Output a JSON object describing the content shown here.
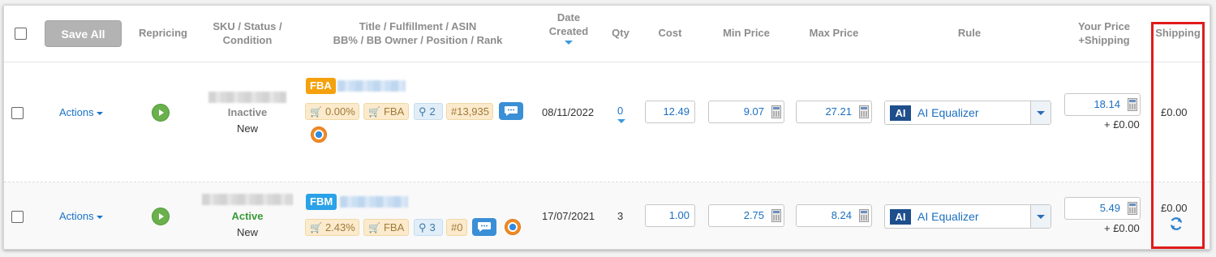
{
  "header": {
    "save_all": "Save All",
    "repricing": "Repricing",
    "sku_line1": "SKU / Status /",
    "sku_line2": "Condition",
    "title_line1": "Title / Fulfillment / ASIN",
    "title_line2": "BB% / BB Owner / Position / Rank",
    "date_line1": "Date",
    "date_line2": "Created",
    "qty": "Qty",
    "cost": "Cost",
    "min_price": "Min Price",
    "max_price": "Max Price",
    "rule": "Rule",
    "your_price_line1": "Your Price",
    "your_price_line2": "+Shipping",
    "shipping": "Shipping"
  },
  "rows": [
    {
      "actions": "Actions",
      "status": "Inactive",
      "condition": "New",
      "fulfillment": "FBA",
      "bb_percent": "0.00%",
      "bb_owner": "FBA",
      "position": "2",
      "rank": "#13,935",
      "date": "08/11/2022",
      "qty": "0",
      "cost": "12.49",
      "min_price": "9.07",
      "max_price": "27.21",
      "rule_badge": "AI",
      "rule": "AI Equalizer",
      "your_price": "18.14",
      "plus_shipping": "+ £0.00",
      "shipping": "£0.00"
    },
    {
      "actions": "Actions",
      "status": "Active",
      "condition": "New",
      "fulfillment": "FBM",
      "bb_percent": "2.43%",
      "bb_owner": "FBA",
      "position": "3",
      "rank": "#0",
      "date": "17/07/2021",
      "qty": "3",
      "cost": "1.00",
      "min_price": "2.75",
      "max_price": "8.24",
      "rule_badge": "AI",
      "rule": "AI Equalizer",
      "your_price": "5.49",
      "plus_shipping": "+ £0.00",
      "shipping": "£0.00"
    }
  ],
  "colors": {
    "fba_tag": "#f5a10c",
    "fbm_tag": "#2aa2e8",
    "active_status": "#3a9a3a",
    "inactive_status": "#888888",
    "link": "#1a73c7",
    "highlight_box": "#e01b1b"
  },
  "icons": [
    "play-icon",
    "cart-icon",
    "location-pin-icon",
    "chat-icon",
    "buybox-orb-icon",
    "calculator-icon",
    "sort-down-icon",
    "refresh-icon",
    "caret-down-icon"
  ]
}
